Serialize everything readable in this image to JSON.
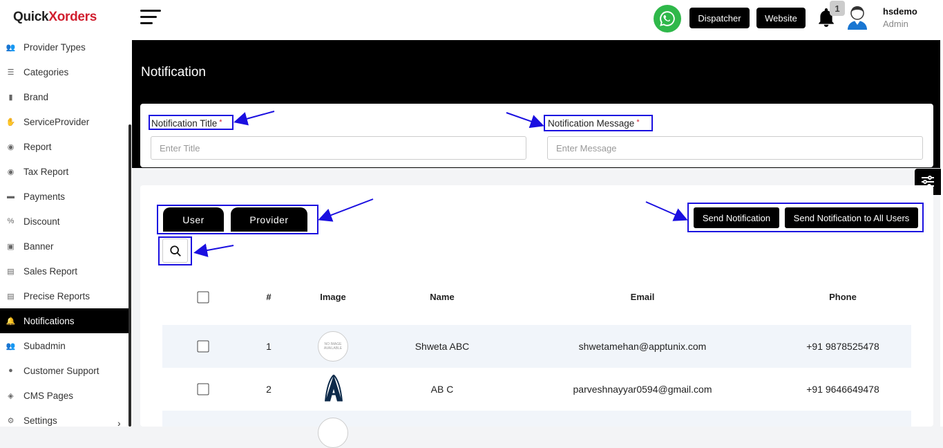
{
  "brand": {
    "part1": "Quick",
    "part2": "orders",
    "x": "X"
  },
  "sidebar": {
    "items": [
      {
        "label": "Provider Types",
        "icon": "users-icon"
      },
      {
        "label": "Categories",
        "icon": "list-icon"
      },
      {
        "label": "Brand",
        "icon": "bookmark-icon"
      },
      {
        "label": "ServiceProvider",
        "icon": "hand-icon"
      },
      {
        "label": "Report",
        "icon": "report-icon"
      },
      {
        "label": "Tax Report",
        "icon": "tax-icon"
      },
      {
        "label": "Payments",
        "icon": "payment-icon"
      },
      {
        "label": "Discount",
        "icon": "discount-icon"
      },
      {
        "label": "Banner",
        "icon": "image-icon"
      },
      {
        "label": "Sales Report",
        "icon": "chart-icon"
      },
      {
        "label": "Precise Reports",
        "icon": "chart-icon"
      },
      {
        "label": "Notifications",
        "icon": "bell-icon",
        "active": true
      },
      {
        "label": "Subadmin",
        "icon": "group-icon"
      },
      {
        "label": "Customer Support",
        "icon": "chat-icon"
      },
      {
        "label": "CMS Pages",
        "icon": "code-icon"
      },
      {
        "label": "Settings",
        "icon": "gear-icon"
      }
    ]
  },
  "topbar": {
    "dispatcher": "Dispatcher",
    "website": "Website",
    "notif_count": "1",
    "user_name": "hsdemo",
    "user_role": "Admin"
  },
  "page": {
    "title": "Notification"
  },
  "form": {
    "title_label": "Notification Title",
    "title_placeholder": "Enter  Title",
    "message_label": "Notification Message",
    "message_placeholder": "Enter  Message",
    "required_mark": "*"
  },
  "tabs": {
    "user": "User",
    "provider": "Provider"
  },
  "actions": {
    "send": "Send Notification",
    "send_all": "Send Notification to All Users"
  },
  "table": {
    "headers": {
      "num": "#",
      "image": "Image",
      "name": "Name",
      "email": "Email",
      "phone": "Phone"
    },
    "rows": [
      {
        "num": "1",
        "name": "Shweta ABC",
        "email": "shwetamehan@apptunix.com",
        "phone": "+91 9878525478",
        "image": "no-image"
      },
      {
        "num": "2",
        "name": "AB C",
        "email": "parveshnayyar0594@gmail.com",
        "phone": "+91 9646649478",
        "image": "logo-a"
      }
    ],
    "no_image_text": "NO IMAGE AVAILABLE"
  },
  "colors": {
    "accent": "#000000",
    "highlight": "#1a0fe0",
    "brand_red": "#d11f2f",
    "whatsapp": "#2fb84a"
  }
}
